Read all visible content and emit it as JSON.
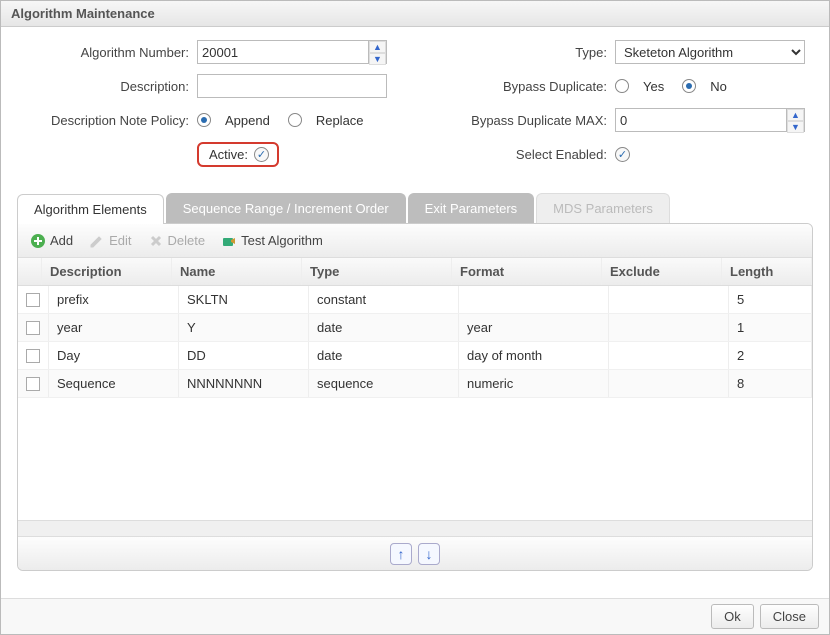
{
  "title": "Algorithm Maintenance",
  "form": {
    "algorithmNumber": {
      "label": "Algorithm Number:",
      "value": "20001"
    },
    "description": {
      "label": "Description:",
      "value": ""
    },
    "descriptionNotePolicy": {
      "label": "Description Note Policy:",
      "options": {
        "append": "Append",
        "replace": "Replace"
      },
      "selected": "append"
    },
    "active": {
      "label": "Active:",
      "checked": true
    },
    "type": {
      "label": "Type:",
      "value": "Sketeton Algorithm"
    },
    "bypassDuplicate": {
      "label": "Bypass Duplicate:",
      "options": {
        "yes": "Yes",
        "no": "No"
      },
      "selected": "no"
    },
    "bypassDuplicateMax": {
      "label": "Bypass Duplicate MAX:",
      "value": "0"
    },
    "selectEnabled": {
      "label": "Select Enabled:",
      "checked": true
    }
  },
  "tabs": {
    "elements": "Algorithm Elements",
    "sequence": "Sequence Range / Increment Order",
    "exit": "Exit Parameters",
    "mds": "MDS Parameters"
  },
  "toolbar": {
    "add": "Add",
    "edit": "Edit",
    "delete": "Delete",
    "test": "Test Algorithm"
  },
  "gridHeaders": {
    "description": "Description",
    "name": "Name",
    "type": "Type",
    "format": "Format",
    "exclude": "Exclude",
    "length": "Length"
  },
  "rows": [
    {
      "description": "prefix",
      "name": "SKLTN",
      "type": "constant",
      "format": "",
      "exclude": "",
      "length": "5"
    },
    {
      "description": "year",
      "name": "Y",
      "type": "date",
      "format": "year",
      "exclude": "",
      "length": "1"
    },
    {
      "description": "Day",
      "name": "DD",
      "type": "date",
      "format": "day of month",
      "exclude": "",
      "length": "2"
    },
    {
      "description": "Sequence",
      "name": "NNNNNNNN",
      "type": "sequence",
      "format": "numeric",
      "exclude": "",
      "length": "8"
    }
  ],
  "buttons": {
    "ok": "Ok",
    "close": "Close"
  }
}
